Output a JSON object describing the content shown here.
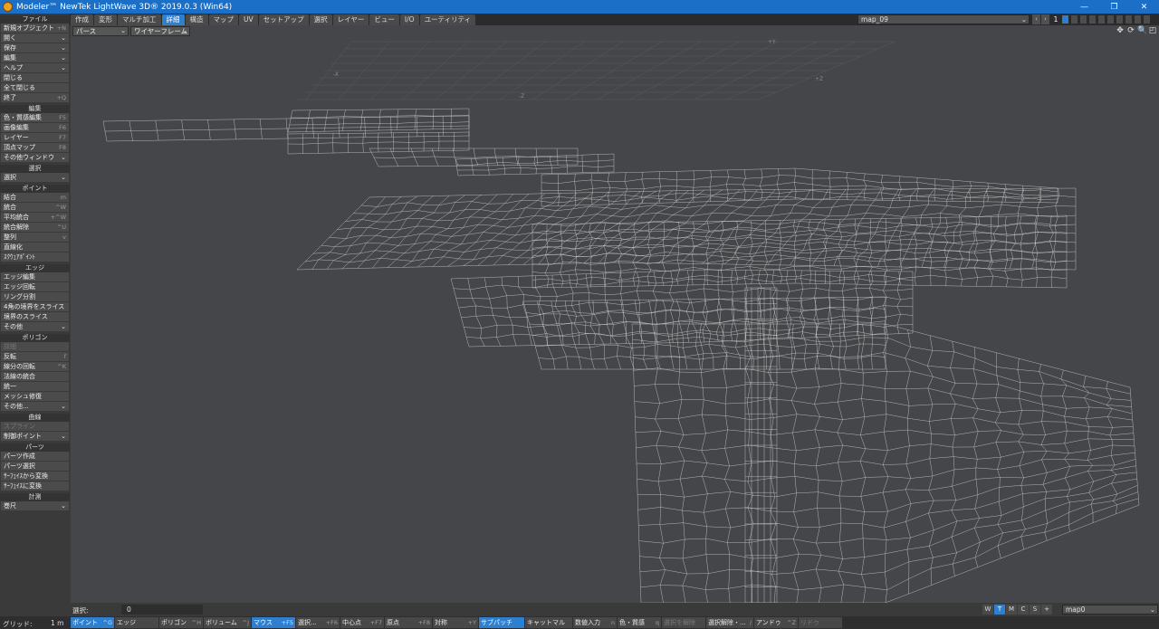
{
  "window": {
    "title": "Modeler™ NewTek LightWave 3D® 2019.0.3 (Win64)",
    "buttons": {
      "minimize": "—",
      "maximize": "❐",
      "close": "✕"
    }
  },
  "tabs": [
    {
      "label": "作成",
      "active": false
    },
    {
      "label": "変形",
      "active": false
    },
    {
      "label": "マルチ加工",
      "active": false
    },
    {
      "label": "詳細",
      "active": true
    },
    {
      "label": "構造",
      "active": false
    },
    {
      "label": "マップ",
      "active": false
    },
    {
      "label": "UV",
      "active": false
    },
    {
      "label": "セットアップ",
      "active": false
    },
    {
      "label": "選択",
      "active": false
    },
    {
      "label": "レイヤー",
      "active": false
    },
    {
      "label": "ビュー",
      "active": false
    },
    {
      "label": "I/O",
      "active": false
    },
    {
      "label": "ユーティリティ",
      "active": false
    }
  ],
  "layer_bar": {
    "object": "map_09",
    "prev": "‹",
    "next": "›",
    "current_layer": "1"
  },
  "sidebar": {
    "file": {
      "header": "ファイル",
      "items": [
        {
          "label": "新規オブジェクト",
          "shortcut": "+N"
        },
        {
          "label": "開く",
          "dropdown": "⌄"
        },
        {
          "label": "保存",
          "dropdown": "⌄"
        },
        {
          "label": "編集",
          "dropdown": "⌄"
        },
        {
          "label": "ヘルプ",
          "dropdown": "⌄"
        },
        {
          "label": "閉じる"
        },
        {
          "label": "全て閉じる"
        },
        {
          "label": "終了",
          "shortcut": "+Q"
        }
      ]
    },
    "edit": {
      "header": "編集",
      "items": [
        {
          "label": "色・質感編集",
          "shortcut": "F5"
        },
        {
          "label": "画像編集",
          "shortcut": "F6"
        },
        {
          "label": "レイヤー",
          "shortcut": "F7"
        },
        {
          "label": "頂点マップ",
          "shortcut": "F8"
        },
        {
          "label": "その他ウィンドウ",
          "dropdown": "⌄"
        }
      ]
    },
    "select": {
      "header": "選択",
      "items": [
        {
          "label": "選択",
          "dropdown": "⌄"
        }
      ]
    },
    "point": {
      "header": "ポイント",
      "items": [
        {
          "label": "結合",
          "shortcut": "m"
        },
        {
          "label": "統合",
          "shortcut": "^W"
        },
        {
          "label": "平均統合",
          "shortcut": "+^W"
        },
        {
          "label": "統合解除",
          "shortcut": "^U"
        },
        {
          "label": "整列",
          "shortcut": "v"
        },
        {
          "label": "直線化"
        },
        {
          "label": "ｽｸｳｪｱﾎﾟｲﾝﾄ"
        }
      ]
    },
    "edge": {
      "header": "エッジ",
      "items": [
        {
          "label": "エッジ編集"
        },
        {
          "label": "エッジ回転"
        },
        {
          "label": "リング分割"
        },
        {
          "label": "4角の境界をスライス"
        },
        {
          "label": "境界のスライス"
        },
        {
          "label": "その他",
          "dropdown": "⌄"
        }
      ]
    },
    "polygon": {
      "header": "ポリゴン",
      "items": [
        {
          "label": "詳細",
          "dim": true
        },
        {
          "label": "反転",
          "shortcut": "f"
        },
        {
          "label": "線分の回転",
          "shortcut": "^K"
        },
        {
          "label": "法線の統合"
        },
        {
          "label": "統一"
        },
        {
          "label": "メッシュ修復"
        },
        {
          "label": "その他...",
          "dropdown": "⌄"
        }
      ]
    },
    "curve": {
      "header": "曲線",
      "items": [
        {
          "label": "スプライン",
          "dim": true
        },
        {
          "label": "制御ポイント",
          "dropdown": "⌄"
        }
      ]
    },
    "parts": {
      "header": "パーツ",
      "items": [
        {
          "label": "パーツ作成"
        },
        {
          "label": "パーツ選択"
        },
        {
          "label": "ｻｰﾌｪｲｽから変換"
        },
        {
          "label": "ｻｰﾌｪｲｽに変換"
        }
      ]
    },
    "measure": {
      "header": "計測",
      "items": [
        {
          "label": "巻尺",
          "dropdown": "⌄"
        }
      ]
    }
  },
  "viewport": {
    "view_type": "パース",
    "render_mode": "ワイヤーフレーム",
    "caret": "⌄",
    "grid_labels": {
      "py": "+Y",
      "mx": "-X",
      "mz": "-Z",
      "pz": "+Z"
    },
    "icons": {
      "move": "✥",
      "rotate": "⟳",
      "zoom": "🔍",
      "maximize": "◰"
    }
  },
  "info_bar": {
    "selection_label": "選択:",
    "selection_count": "0",
    "view_buttons": [
      {
        "label": "W",
        "active": false
      },
      {
        "label": "T",
        "active": true
      },
      {
        "label": "M",
        "active": false
      },
      {
        "label": "C",
        "active": false
      },
      {
        "label": "S",
        "active": false
      },
      {
        "label": "+",
        "active": false
      }
    ],
    "vmap": "map0"
  },
  "bottom_bar": {
    "grid_label": "グリッド:",
    "grid_value": "1 m",
    "buttons": [
      {
        "label": "ポイント",
        "shortcut": "^G",
        "active": true,
        "w": 48
      },
      {
        "label": "エッジ",
        "shortcut": "",
        "active": false,
        "w": 48
      },
      {
        "label": "ポリゴン",
        "shortcut": "^H",
        "active": false,
        "w": 48
      },
      {
        "label": "ボリューム",
        "shortcut": "^J",
        "active": false,
        "w": 52
      },
      {
        "label": "マウス",
        "shortcut": "+F5",
        "active": true,
        "w": 48
      },
      {
        "label": "選択...",
        "shortcut": "+F6",
        "active": false,
        "w": 48
      },
      {
        "label": "中心点",
        "shortcut": "+F7",
        "active": false,
        "w": 48
      },
      {
        "label": "原点",
        "shortcut": "+F8",
        "active": false,
        "w": 52
      },
      {
        "label": "対称",
        "shortcut": "+Y",
        "active": false,
        "w": 50
      },
      {
        "label": "サブパッチ",
        "shortcut": "",
        "active": true,
        "w": 50
      },
      {
        "label": "キャットマル",
        "shortcut": "",
        "active": false,
        "w": 52
      },
      {
        "label": "数値入力",
        "shortcut": "n",
        "active": false,
        "w": 48
      },
      {
        "label": "色・質感",
        "shortcut": "q",
        "active": false,
        "w": 48
      },
      {
        "label": "選択を解除",
        "shortcut": "",
        "active": false,
        "dim": true,
        "w": 48
      },
      {
        "label": "選択解除・...",
        "shortcut": "/",
        "active": false,
        "w": 52
      },
      {
        "label": "アンドゥ",
        "shortcut": "^Z",
        "active": false,
        "w": 48
      },
      {
        "label": "リドゥ",
        "shortcut": "",
        "active": false,
        "dim": true,
        "w": 48
      }
    ]
  },
  "colors": {
    "accent": "#2f7fd0",
    "viewport_bg": "#454649",
    "wire": "#d8d8d8",
    "titlebar": "#1b6fc7"
  }
}
